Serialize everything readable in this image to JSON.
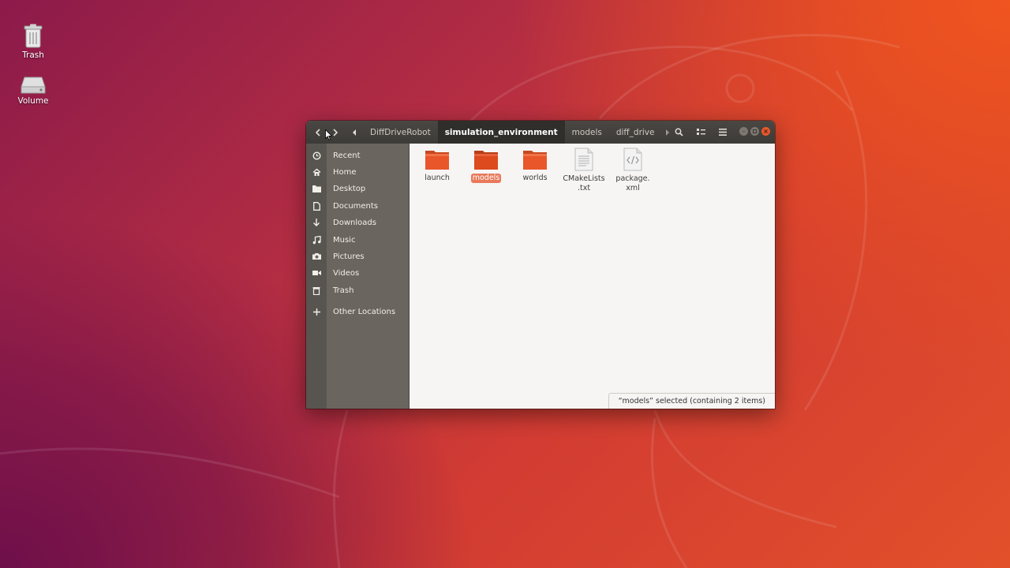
{
  "desktop": {
    "icons": [
      {
        "label": "Trash",
        "icon": "trash-icon"
      },
      {
        "label": "Volume",
        "icon": "drive-icon"
      }
    ]
  },
  "window": {
    "nav": {
      "back": "back-arrow-icon",
      "forward": "forward-arrow-icon",
      "scroll_left": "breadcrumb-scroll-left-icon",
      "scroll_right": "breadcrumb-scroll-right-icon"
    },
    "breadcrumbs": [
      "DiffDriveRobot",
      "simulation_environment",
      "models",
      "diff_drive"
    ],
    "active_breadcrumb": "simulation_environment",
    "toolbar_icons": [
      "search-icon",
      "view-options-icon",
      "hamburger-menu-icon"
    ],
    "window_controls": [
      "minimize",
      "maximize",
      "close"
    ]
  },
  "sidebar": {
    "items": [
      {
        "label": "Recent",
        "icon": "clock-icon"
      },
      {
        "label": "Home",
        "icon": "home-icon"
      },
      {
        "label": "Desktop",
        "icon": "folder-icon"
      },
      {
        "label": "Documents",
        "icon": "document-icon"
      },
      {
        "label": "Downloads",
        "icon": "download-arrow-icon"
      },
      {
        "label": "Music",
        "icon": "music-note-icon"
      },
      {
        "label": "Pictures",
        "icon": "camera-icon"
      },
      {
        "label": "Videos",
        "icon": "video-camera-icon"
      },
      {
        "label": "Trash",
        "icon": "trash-icon"
      },
      {
        "label": "Other Locations",
        "icon": "plus-icon"
      }
    ]
  },
  "files": [
    {
      "name": "launch",
      "type": "folder",
      "selected": false
    },
    {
      "name": "models",
      "type": "folder",
      "selected": true
    },
    {
      "name": "worlds",
      "type": "folder",
      "selected": false
    },
    {
      "name_line1": "CMakeLists",
      "name_line2": ".txt",
      "type": "text-file",
      "selected": false
    },
    {
      "name_line1": "package.",
      "name_line2": "xml",
      "type": "xml-file",
      "selected": false
    }
  ],
  "status": "“models” selected  (containing 2 items)",
  "colors": {
    "accent": "#e9795a",
    "folder": "#e8562a",
    "headerbar": "#3d3b38",
    "sidebar": "#6a655e"
  }
}
